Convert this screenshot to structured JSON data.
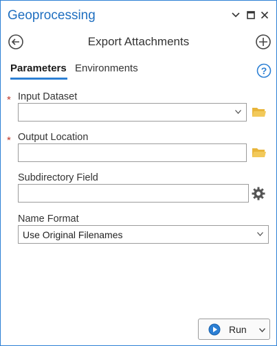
{
  "pane": {
    "title": "Geoprocessing",
    "controls": {
      "options_icon": "chevron-down-icon",
      "maximize_icon": "maximize-icon",
      "close_icon": "close-icon"
    }
  },
  "tool": {
    "title": "Export Attachments",
    "back_icon": "back-icon",
    "add_icon": "add-icon"
  },
  "tabs": [
    {
      "label": "Parameters",
      "active": true
    },
    {
      "label": "Environments",
      "active": false
    }
  ],
  "help_icon": "help-icon",
  "parameters": {
    "input_dataset": {
      "label": "Input Dataset",
      "required": "*",
      "value": ""
    },
    "output_location": {
      "label": "Output Location",
      "required": "*",
      "value": ""
    },
    "subdirectory_field": {
      "label": "Subdirectory Field",
      "value": ""
    },
    "name_format": {
      "label": "Name Format",
      "value": "Use Original Filenames"
    }
  },
  "run_button": {
    "label": "Run"
  },
  "colors": {
    "accent": "#1f6fc0",
    "required": "#c0392b",
    "folder": "#e8b53a"
  }
}
